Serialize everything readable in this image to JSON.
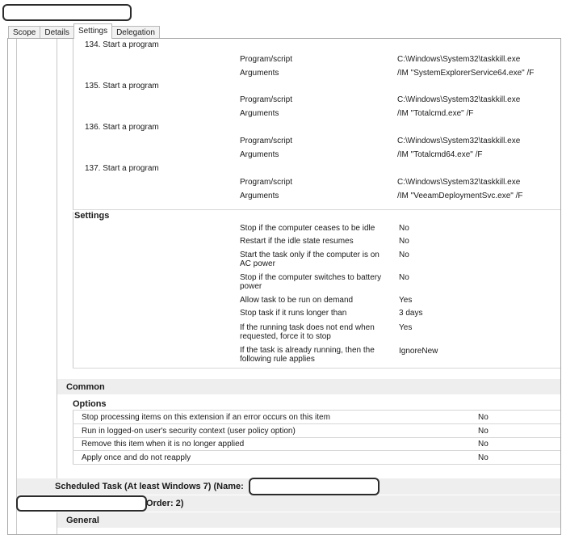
{
  "tabs": [
    "Scope",
    "Details",
    "Settings",
    "Delegation"
  ],
  "actions": [
    {
      "heading": "134. Start a program",
      "program_label": "Program/script",
      "program_value": "C:\\Windows\\System32\\taskkill.exe",
      "args_label": "Arguments",
      "args_value": "/IM \"SystemExplorerService64.exe\" /F"
    },
    {
      "heading": "135. Start a program",
      "program_label": "Program/script",
      "program_value": "C:\\Windows\\System32\\taskkill.exe",
      "args_label": "Arguments",
      "args_value": "/IM \"Totalcmd.exe\" /F"
    },
    {
      "heading": "136. Start a program",
      "program_label": "Program/script",
      "program_value": "C:\\Windows\\System32\\taskkill.exe",
      "args_label": "Arguments",
      "args_value": "/IM \"Totalcmd64.exe\" /F"
    },
    {
      "heading": "137. Start a program",
      "program_label": "Program/script",
      "program_value": "C:\\Windows\\System32\\taskkill.exe",
      "args_label": "Arguments",
      "args_value": "/IM \"VeeamDeploymentSvc.exe\" /F"
    }
  ],
  "settings": {
    "title": "Settings",
    "rows": [
      {
        "label": "Stop if the computer ceases to be idle",
        "value": "No"
      },
      {
        "label": "Restart if the idle state resumes",
        "value": "No"
      },
      {
        "label": "Start the task only if the computer is on AC power",
        "value": "No"
      },
      {
        "label": "Stop if the computer switches to battery power",
        "value": "No"
      },
      {
        "label": "Allow task to be run on demand",
        "value": "Yes"
      },
      {
        "label": "Stop task if it runs longer than",
        "value": "3 days"
      },
      {
        "label": "If the running task does not end when requested, force it to stop",
        "value": "Yes"
      },
      {
        "label": "If the task is already running, then the following rule applies",
        "value": "IgnoreNew"
      }
    ]
  },
  "common": {
    "title": "Common",
    "options_title": "Options",
    "rows": [
      {
        "label": "Stop processing items on this extension if an error occurs on this item",
        "value": "No"
      },
      {
        "label": "Run in logged-on user's security context (user policy option)",
        "value": "No"
      },
      {
        "label": "Remove this item when it is no longer applied",
        "value": "No"
      },
      {
        "label": "Apply once and do not reapply",
        "value": "No"
      }
    ]
  },
  "scheduled_task": {
    "header": "Scheduled Task (At least Windows 7) (Name:",
    "order": "Order: 2)",
    "general": "General"
  }
}
